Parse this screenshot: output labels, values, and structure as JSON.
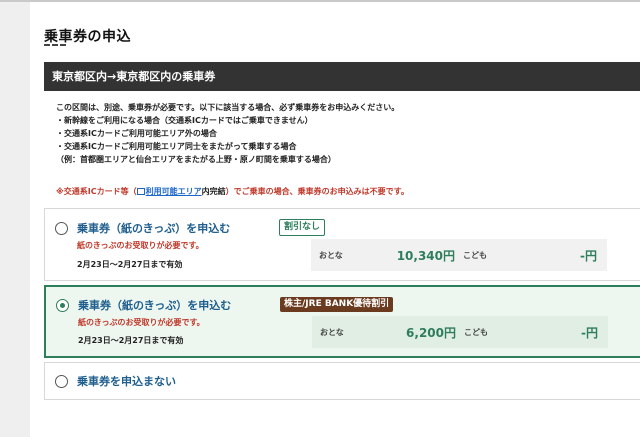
{
  "page": {
    "title": "乗車券の申込"
  },
  "section": {
    "header": "東京都区内→東京都区内の乗車券"
  },
  "notes": [
    "この区間は、別途、乗車券が必要です。以下に該当する場合、必ず乗車券をお申込みください。",
    "・新幹線をご利用になる場合（交通系ICカードではご乗車できません）",
    "・交通系ICカードご利用可能エリア外の場合",
    "・交通系ICカードご利用可能エリア同士をまたがって乗車する場合",
    "（例：首都圏エリアと仙台エリアをまたがる上野・原ノ町間を乗車する場合）"
  ],
  "ic_note": {
    "prefix": "※交通系ICカード等（",
    "link": "利用可能エリア",
    "suffix_black": "内完結",
    "suffix": "）でご乗車の場合、乗車券のお申込みは不要です。"
  },
  "options": [
    {
      "label": "乗車券（紙のきっぷ）を申込む",
      "badge": "割引なし",
      "requirement": "紙のきっぷのお受取りが必要です。",
      "validity": "2月23日～2月27日まで有効",
      "adult_label": "おとな",
      "adult_price": "10,340円",
      "child_label": "こども",
      "child_price": "-円",
      "selected": false
    },
    {
      "label": "乗車券（紙のきっぷ）を申込む",
      "badge": "株主/JRE BANK優待割引",
      "requirement": "紙のきっぷのお受取りが必要です。",
      "validity": "2月23日～2月27日まで有効",
      "adult_label": "おとな",
      "adult_price": "6,200円",
      "child_label": "こども",
      "child_price": "-円",
      "selected": true
    },
    {
      "label": "乗車券を申込まない",
      "selected": false
    }
  ],
  "colors": {
    "accent_green": "#2e7d5b",
    "link_blue": "#1f5f8f",
    "warning_red": "#c0392b",
    "header_dark": "#333333",
    "badge_brown": "#6b3b1f"
  }
}
